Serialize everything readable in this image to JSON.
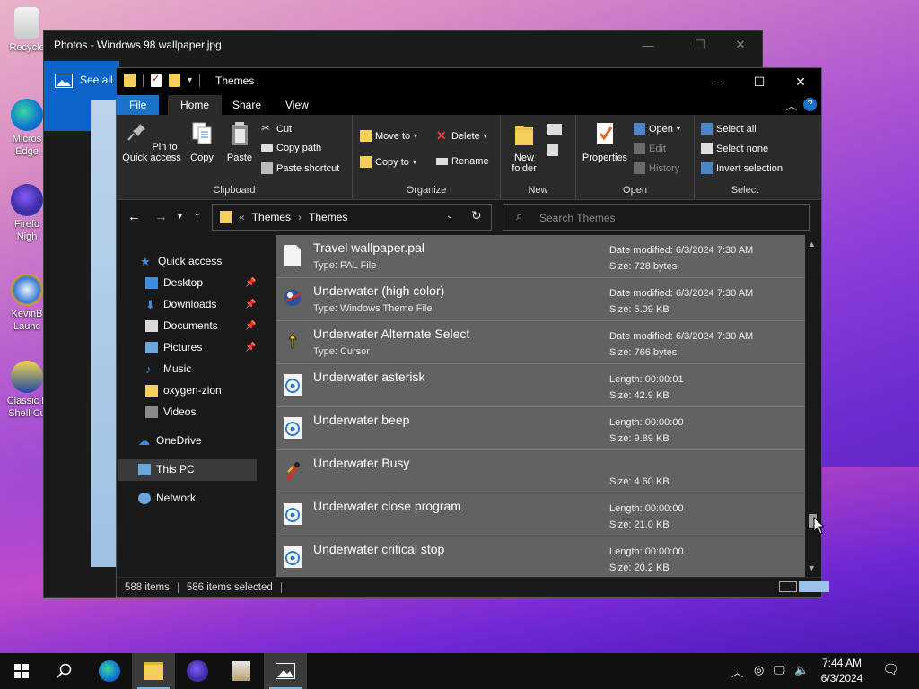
{
  "desktop": {
    "icons": [
      {
        "label": "Recycle",
        "icon": "recycle-bin-icon"
      },
      {
        "label": "Micros Edge",
        "icon": "edge-icon"
      },
      {
        "label": "Firefo Nigh",
        "icon": "firefox-icon"
      },
      {
        "label": "KevinB Launc",
        "icon": "launcher-icon"
      },
      {
        "label": "Classic L Shell Cu",
        "icon": "classic-shell-icon"
      }
    ]
  },
  "photos": {
    "title": "Photos - Windows 98 wallpaper.jpg",
    "see_all": "See all p"
  },
  "explorer": {
    "title": "Themes",
    "tabs": {
      "file": "File",
      "home": "Home",
      "share": "Share",
      "view": "View"
    },
    "ribbon": {
      "clipboard": {
        "title": "Clipboard",
        "pin": "Pin to Quick access",
        "copy": "Copy",
        "paste": "Paste",
        "cut": "Cut",
        "copy_path": "Copy path",
        "paste_shortcut": "Paste shortcut"
      },
      "organize": {
        "title": "Organize",
        "move_to": "Move to",
        "copy_to": "Copy to",
        "delete": "Delete",
        "rename": "Rename"
      },
      "new": {
        "title": "New",
        "new_folder": "New folder"
      },
      "open": {
        "title": "Open",
        "properties": "Properties",
        "open": "Open",
        "edit": "Edit",
        "history": "History"
      },
      "select": {
        "title": "Select",
        "select_all": "Select all",
        "select_none": "Select none",
        "invert": "Invert selection"
      }
    },
    "address": {
      "crumbs": [
        "Themes",
        "Themes"
      ],
      "prefix": "«"
    },
    "search": {
      "placeholder": "Search Themes"
    },
    "nav": {
      "quick_access": "Quick access",
      "items": [
        "Desktop",
        "Downloads",
        "Documents",
        "Pictures",
        "Music",
        "oxygen-zion",
        "Videos"
      ],
      "onedrive": "OneDrive",
      "this_pc": "This PC",
      "network": "Network"
    },
    "files": [
      {
        "name": "Travel wallpaper.pal",
        "type": "Type: PAL File",
        "m1": "Date modified: 6/3/2024 7:30 AM",
        "m2": "Size: 728 bytes",
        "icon": "document-icon"
      },
      {
        "name": "Underwater (high color)",
        "type": "Type: Windows Theme File",
        "m1": "Date modified: 6/3/2024 7:30 AM",
        "m2": "Size: 5.09 KB",
        "icon": "theme-file-icon"
      },
      {
        "name": "Underwater Alternate Select",
        "type": "Type: Cursor",
        "m1": "Date modified: 6/3/2024 7:30 AM",
        "m2": "Size: 766 bytes",
        "icon": "cursor-file-icon"
      },
      {
        "name": "Underwater asterisk",
        "type": "",
        "m1": "Length: 00:00:01",
        "m2": "Size: 42.9 KB",
        "icon": "audio-file-icon"
      },
      {
        "name": "Underwater beep",
        "type": "",
        "m1": "Length: 00:00:00",
        "m2": "Size: 9.89 KB",
        "icon": "audio-file-icon"
      },
      {
        "name": "Underwater Busy",
        "type": "",
        "m1": "",
        "m2": "Size: 4.60 KB",
        "icon": "animated-cursor-icon"
      },
      {
        "name": "Underwater close program",
        "type": "",
        "m1": "Length: 00:00:00",
        "m2": "Size: 21.0 KB",
        "icon": "audio-file-icon"
      },
      {
        "name": "Underwater critical stop",
        "type": "",
        "m1": "Length: 00:00:00",
        "m2": "Size: 20.2 KB",
        "icon": "audio-file-icon"
      }
    ],
    "status": {
      "items": "588 items",
      "selected": "586 items selected"
    }
  },
  "taskbar": {
    "time": "7:44 AM",
    "date": "6/3/2024"
  },
  "colors": {
    "accent": "#1a73c9",
    "row_selected": "#626262",
    "folder": "#f5cf5b"
  }
}
